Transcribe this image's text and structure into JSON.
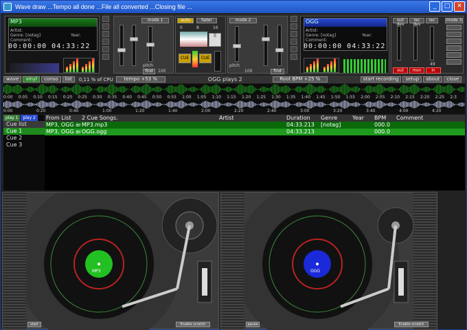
{
  "window": {
    "title": "Wave draw ...Tempo all done ...File all converted ...Closing file ...",
    "minimize": "_",
    "maximize": "□",
    "close": "✕"
  },
  "deck1": {
    "filename": "MP3",
    "artist_label": "Artist:",
    "genre_label": "Genre: [notag]",
    "year_label": "Year:",
    "comment_label": "Comment:",
    "time_left": "00:00:00  04:33:22",
    "mode": "mode 1"
  },
  "deck2": {
    "filename": "OGG",
    "artist_label": "Artist:",
    "genre_label": "Genre: [notag]",
    "year_label": "Year:",
    "comment_label": "Comment:",
    "time_left": "00:00:00  04:33:22",
    "mode": "mode 2"
  },
  "mixer": {
    "auto": "auto",
    "fader": "fader",
    "cue1": "CUE",
    "cue2": "CUE",
    "pitch": "pitch",
    "bpm1": "100",
    "bpm2": "100",
    "find1": "find",
    "find2": "find",
    "radio_labels": [
      "0",
      "8",
      "16"
    ]
  },
  "right_panel": {
    "out_dev": "out dev",
    "rec_dev": "rec dev",
    "rec": "rec",
    "mode3": "mode 3",
    "out": "out",
    "mon": "mon",
    "in": "in",
    "vol": "49"
  },
  "toolbar": {
    "wave": "wave",
    "vinyl": "vinyl",
    "conso": "conso",
    "list": "list",
    "cpu": "0,11 % of CPU",
    "tempo": "tempo +53 %",
    "now_playing": "OGG plays 2",
    "root_bpm": "Root BPM +25 %",
    "start_recording": "start recording",
    "setup": "setup",
    "about": "about",
    "close": "close"
  },
  "timeline1": [
    "0:00",
    "0:05",
    "0:10",
    "0:15",
    "0:20",
    "0:25",
    "0:30",
    "0:35",
    "0:40",
    "0:45",
    "0:50",
    "0:55",
    "1:00",
    "1:05",
    "1:10",
    "1:15",
    "1:20",
    "1:25",
    "1:30",
    "1:35",
    "1:40",
    "1:45",
    "1:50",
    "1:55",
    "2:00",
    "2:05",
    "2:10",
    "2:15",
    "2:20",
    "2:25",
    "2:3"
  ],
  "timeline2": [
    "0:00",
    "0:20",
    "0:40",
    "1:00",
    "1:20",
    "1:40",
    "2:00",
    "2:20",
    "2:40",
    "3:00",
    "3:20",
    "3:40",
    "4:00",
    "4:20"
  ],
  "timeline3": [
    "0:00",
    "0:20",
    "0:40",
    "0:50",
    "1:00",
    "1:10",
    "1:20",
    "1:30",
    "1:40",
    "2:00",
    "2:10",
    "2:20",
    "2:40",
    "3:00",
    "3:20",
    "3:40",
    "4:00",
    "4:20"
  ],
  "cue_panel": {
    "tabs": [
      "play 1",
      "play 2"
    ],
    "items": [
      "Cue list",
      "Cue 1",
      "Cue 2",
      "Cue 3"
    ]
  },
  "song_list": {
    "headers": [
      "From List",
      "2 Cue Songs.",
      "Artist",
      "Duration",
      "Genre",
      "Year",
      "BPM",
      "Comment"
    ],
    "rows": [
      [
        "MP3, OGG ar",
        "MP3.mp3",
        "",
        "04:33.213",
        "[notag]",
        "",
        "000.0",
        ""
      ],
      [
        "MP3, OGG ar",
        "OGG.ogg",
        "",
        "04:33.213",
        "",
        "",
        "000.0",
        ""
      ]
    ]
  },
  "turntable1": {
    "label": "MP3",
    "left_button": "start",
    "scratch": "Enable scratch"
  },
  "turntable2": {
    "label": "OGG",
    "left_button": "pause",
    "scratch": "Enable scratch"
  },
  "colors": {
    "deck1_accent": "#1e9a1e",
    "deck2_accent": "#2a4ad0",
    "record_label1": "#22c022",
    "record_label2": "#1a2ad8"
  }
}
